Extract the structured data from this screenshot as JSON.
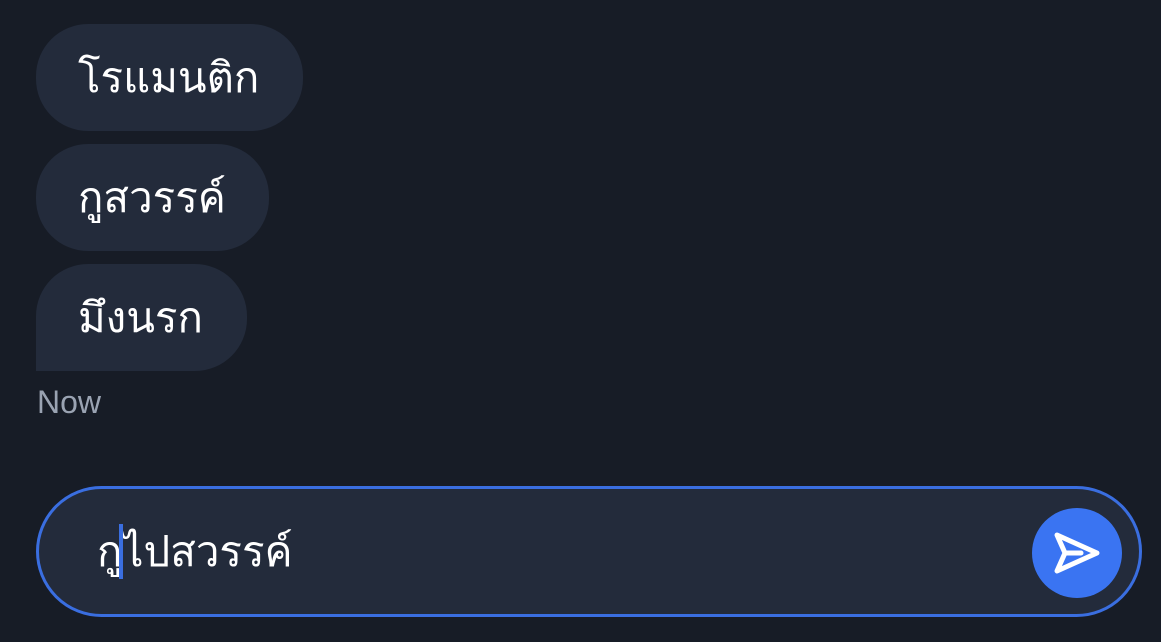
{
  "messages": [
    {
      "text": "โรแมนติก"
    },
    {
      "text": "กูสวรรค์"
    },
    {
      "text": "มึงนรก"
    }
  ],
  "timestamp": "Now",
  "composer": {
    "value": "กูไปสวรรค์",
    "send_icon": "send-icon"
  },
  "colors": {
    "background": "#171c26",
    "bubble": "#232b3b",
    "accent": "#3a6ee0",
    "send_button": "#3a74f2"
  }
}
